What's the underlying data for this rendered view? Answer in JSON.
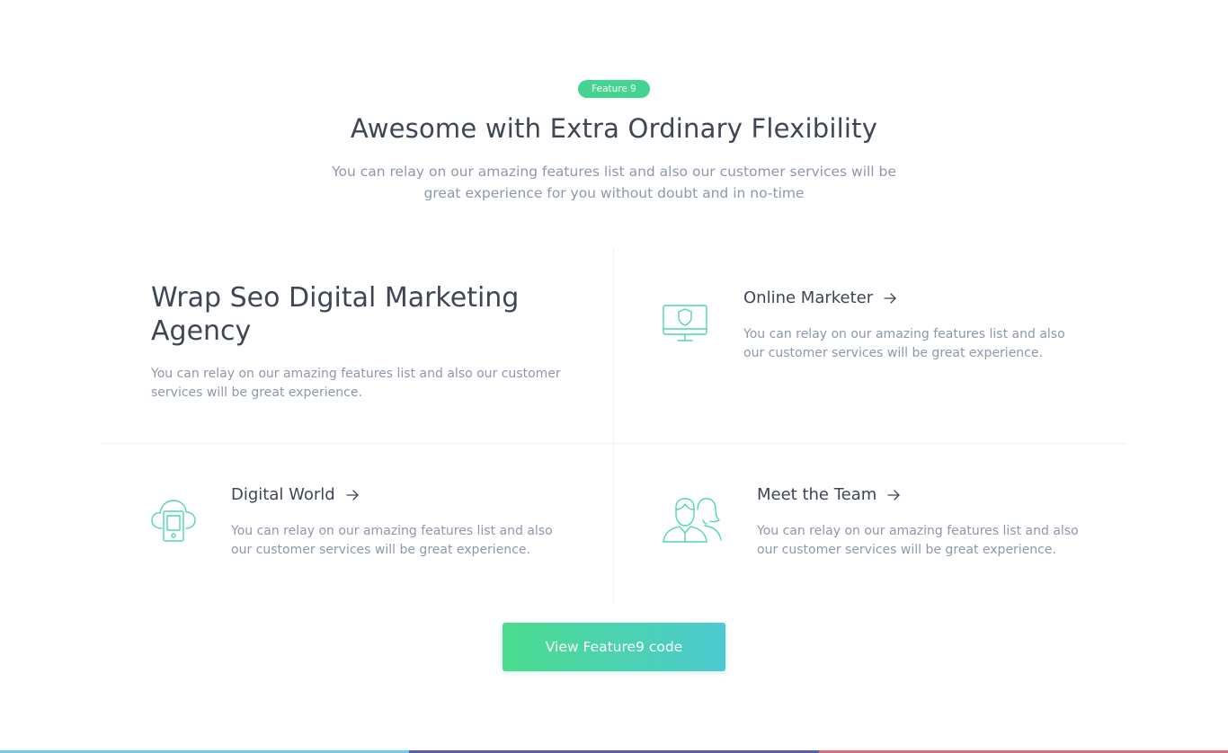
{
  "header": {
    "badge": "Feature 9",
    "title": "Awesome with Extra Ordinary Flexibility",
    "subtitle": "You can relay on our amazing features list and also our customer services will be great experience for you without doubt and in no-time"
  },
  "intro": {
    "title": "Wrap Seo Digital Marketing Agency",
    "text": "You can relay on our amazing features list and also our customer services will be great experience."
  },
  "features": [
    {
      "title": "Online Marketer",
      "text": "You can relay on our amazing features list and also our customer services will be great experience.",
      "icon": "monitor-shield-icon"
    },
    {
      "title": "Digital World",
      "text": "You can relay on our amazing features list and also our customer services will be great experience.",
      "icon": "cloud-phone-icon"
    },
    {
      "title": "Meet the Team",
      "text": "You can relay on our amazing features list and also our customer services will be great experience.",
      "icon": "team-icon"
    }
  ],
  "cta": {
    "label": "View Feature9 code"
  },
  "colors": {
    "accent": "#44d490",
    "gradient_start": "#4bdc8e",
    "gradient_end": "#4cc9cf",
    "heading": "#3e4555",
    "body_text": "#8d97ad",
    "icon_stroke": "#4fd6b0"
  }
}
